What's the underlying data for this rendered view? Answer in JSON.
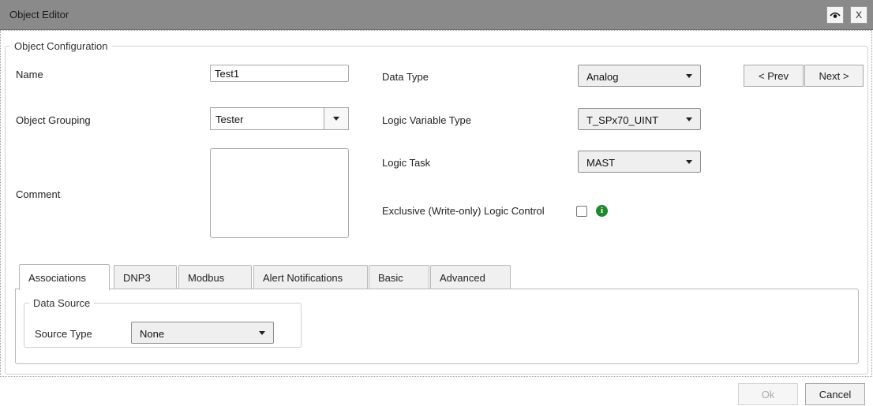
{
  "window": {
    "title": "Object Editor",
    "close_label": "X"
  },
  "config": {
    "group_title": "Object Configuration",
    "name_label": "Name",
    "name_value": "Test1",
    "grouping_label": "Object Grouping",
    "grouping_value": "Tester",
    "comment_label": "Comment",
    "datatype_label": "Data Type",
    "datatype_value": "Analog",
    "logicvar_label": "Logic Variable Type",
    "logicvar_value": "T_SPx70_UINT",
    "logictask_label": "Logic Task",
    "logictask_value": "MAST",
    "exclusive_label": "Exclusive (Write-only) Logic Control",
    "exclusive_checked": false,
    "prev_label": "< Prev",
    "next_label": "Next >"
  },
  "tabs": [
    {
      "label": "Associations",
      "active": true
    },
    {
      "label": "DNP3",
      "active": false
    },
    {
      "label": "Modbus",
      "active": false
    },
    {
      "label": "Alert Notifications",
      "active": false
    },
    {
      "label": "Basic",
      "active": false
    },
    {
      "label": "Advanced",
      "active": false
    }
  ],
  "associations": {
    "datasource_title": "Data Source",
    "source_type_label": "Source Type",
    "source_type_value": "None"
  },
  "footer": {
    "ok_label": "Ok",
    "cancel_label": "Cancel"
  },
  "icons": {
    "visibility": "eye-icon",
    "info": "info-icon",
    "dropdown": "chevron-down-icon"
  },
  "colors": {
    "titlebar": "#8a8a8a",
    "info": "#1e8a2e"
  }
}
